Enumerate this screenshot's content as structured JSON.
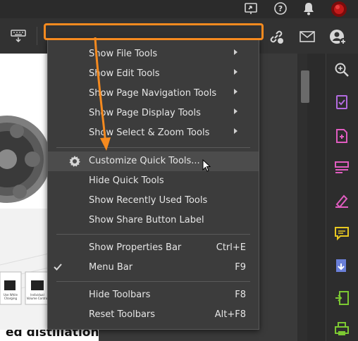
{
  "menu": {
    "items": [
      {
        "label": "Show File Tools",
        "submenu": true
      },
      {
        "label": "Show Edit Tools",
        "submenu": true
      },
      {
        "label": "Show Page Navigation Tools",
        "submenu": true
      },
      {
        "label": "Show Page Display Tools",
        "submenu": true
      },
      {
        "label": "Show Select & Zoom Tools",
        "submenu": true
      },
      {
        "label": "Customize Quick Tools...",
        "icon": "gear-icon",
        "highlighted": true
      },
      {
        "label": "Hide Quick Tools"
      },
      {
        "label": "Show Recently Used Tools"
      },
      {
        "label": "Show Share Button Label"
      },
      {
        "label": "Show Properties Bar",
        "shortcut": "Ctrl+E"
      },
      {
        "label": "Menu Bar",
        "shortcut": "F9",
        "checked": true
      },
      {
        "label": "Hide Toolbars",
        "shortcut": "F8"
      },
      {
        "label": "Reset Toolbars",
        "shortcut": "Alt+F8"
      }
    ]
  },
  "topbar": {
    "icons": [
      "share-screen-icon",
      "help-icon",
      "bell-icon",
      "avatar"
    ]
  },
  "toolbar": {
    "icons": [
      "keyboard-icon",
      "link-icon",
      "email-icon",
      "add-user-icon"
    ]
  },
  "rail": {
    "icons": [
      "zoom-icon",
      "form-check-icon",
      "create-pdf-icon",
      "organize-icon",
      "sign-icon",
      "comment-icon",
      "export-icon",
      "compress-icon",
      "print-icon"
    ]
  },
  "document": {
    "captions": [
      "Use While Charging",
      "Individual Volume Control"
    ],
    "bottom_text": "ed distillation"
  },
  "colors": {
    "annotation": "#f58a1f",
    "menu_bg": "#3c3c3c",
    "menu_highlight": "#4c4c4c",
    "rail_purple": "#b36be0",
    "rail_pink": "#e05cc0",
    "rail_yellow": "#e8c820",
    "rail_green": "#7cc832"
  }
}
